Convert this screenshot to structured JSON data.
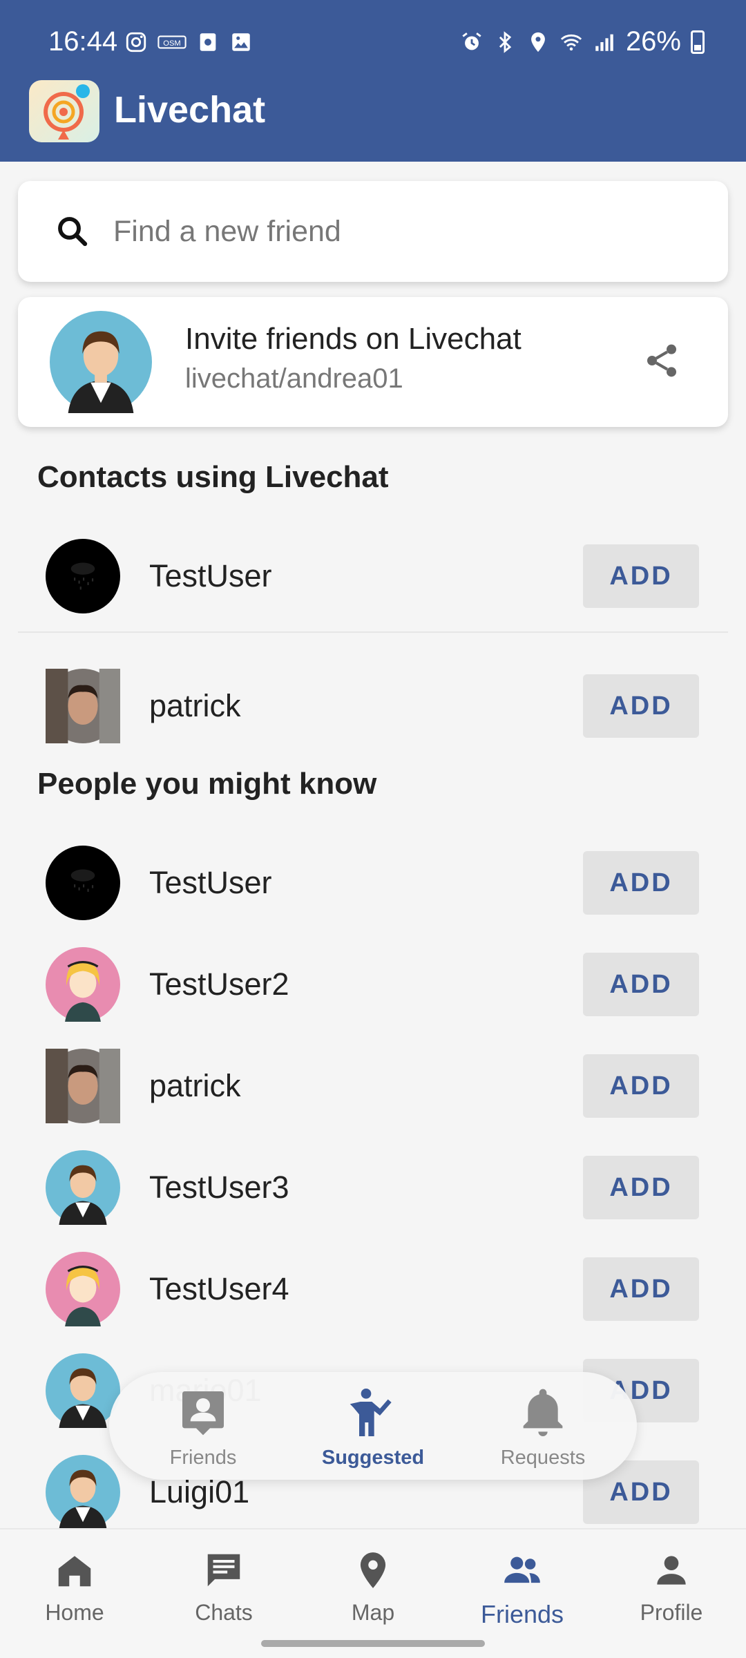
{
  "status_bar": {
    "time": "16:44",
    "battery": "26%"
  },
  "app": {
    "title": "Livechat"
  },
  "search": {
    "placeholder": "Find a new friend"
  },
  "invite": {
    "title": "Invite friends on Livechat",
    "link": "livechat/andrea01"
  },
  "contacts_section": {
    "title": "Contacts using Livechat",
    "items": [
      {
        "name": "TestUser",
        "avatar": "dark-rain-avatar",
        "button": "ADD"
      },
      {
        "name": "patrick",
        "avatar": "photo-avatar-patrick",
        "button": "ADD"
      }
    ]
  },
  "suggestions_section": {
    "title": "People you might know",
    "items": [
      {
        "name": "TestUser",
        "avatar": "dark-rain-avatar",
        "button": "ADD"
      },
      {
        "name": "TestUser2",
        "avatar": "girl-avatar",
        "button": "ADD"
      },
      {
        "name": "patrick",
        "avatar": "photo-avatar-patrick",
        "button": "ADD"
      },
      {
        "name": "TestUser3",
        "avatar": "boy-avatar",
        "button": "ADD"
      },
      {
        "name": "TestUser4",
        "avatar": "girl-avatar",
        "button": "ADD"
      },
      {
        "name": "mario01",
        "avatar": "boy-avatar",
        "button": "ADD"
      },
      {
        "name": "Luigi01",
        "avatar": "boy-avatar",
        "button": "ADD"
      }
    ]
  },
  "floating_tabs": [
    {
      "label": "Friends",
      "icon": "contact-card-icon",
      "active": false
    },
    {
      "label": "Suggested",
      "icon": "person-waving-icon",
      "active": true
    },
    {
      "label": "Requests",
      "icon": "bell-icon",
      "active": false
    }
  ],
  "bottom_nav": [
    {
      "label": "Home",
      "icon": "home-icon",
      "active": false
    },
    {
      "label": "Chats",
      "icon": "chat-icon",
      "active": false
    },
    {
      "label": "Map",
      "icon": "map-pin-icon",
      "active": false
    },
    {
      "label": "Friends",
      "icon": "people-icon",
      "active": true
    },
    {
      "label": "Profile",
      "icon": "person-icon",
      "active": false
    }
  ],
  "colors": {
    "primary": "#3c5a98",
    "button_bg": "#e2e2e2",
    "inactive": "#777777"
  }
}
